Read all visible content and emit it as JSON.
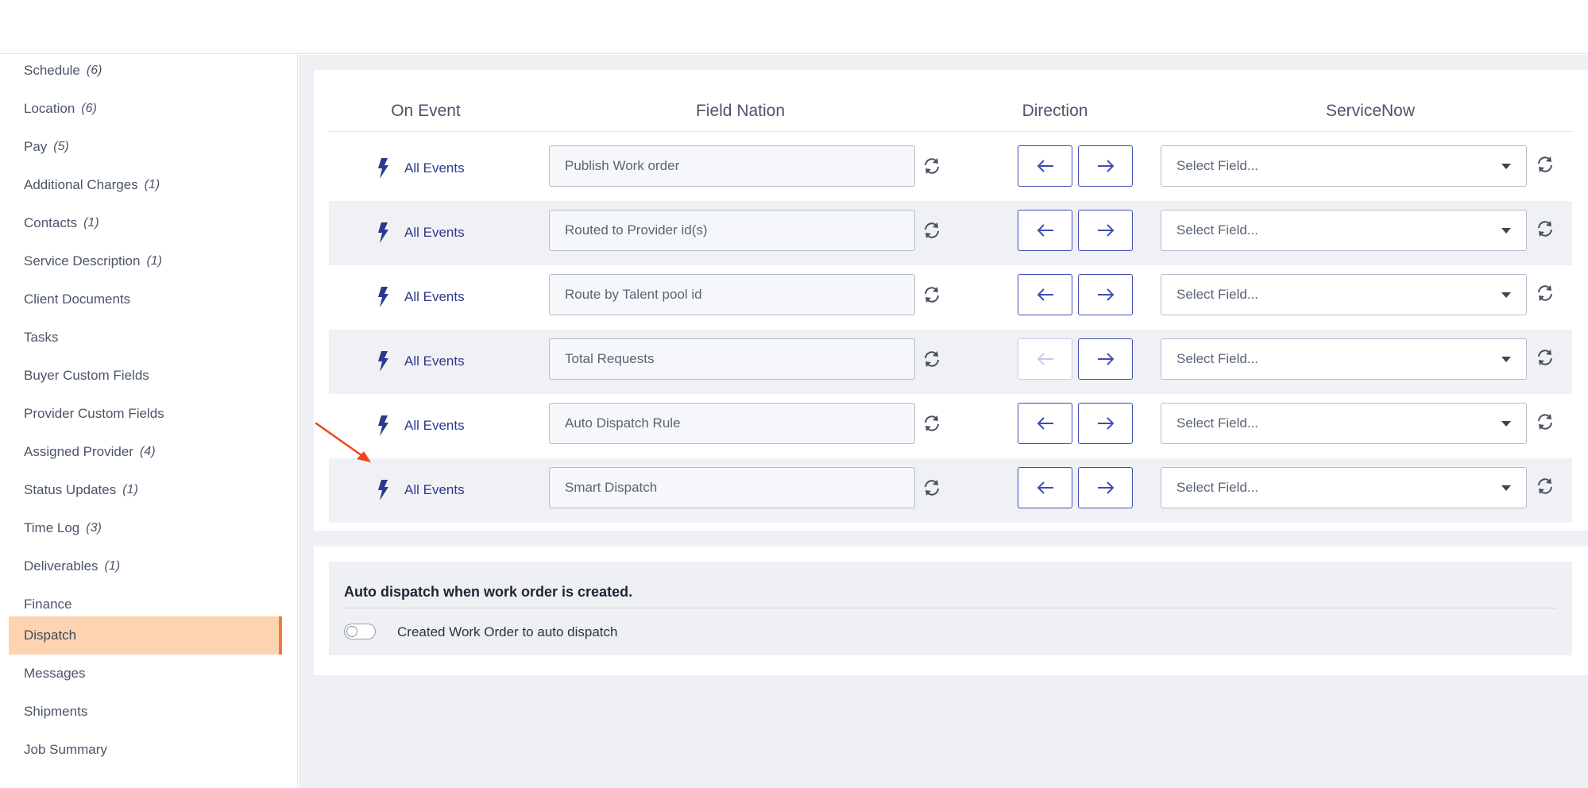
{
  "sidebar": {
    "items": [
      {
        "label": "Schedule",
        "count": "(6)"
      },
      {
        "label": "Location",
        "count": "(6)"
      },
      {
        "label": "Pay",
        "count": "(5)"
      },
      {
        "label": "Additional Charges",
        "count": "(1)"
      },
      {
        "label": "Contacts",
        "count": "(1)"
      },
      {
        "label": "Service Description",
        "count": "(1)"
      },
      {
        "label": "Client Documents",
        "count": ""
      },
      {
        "label": "Tasks",
        "count": ""
      },
      {
        "label": "Buyer Custom Fields",
        "count": ""
      },
      {
        "label": "Provider Custom Fields",
        "count": ""
      },
      {
        "label": "Assigned Provider",
        "count": "(4)"
      },
      {
        "label": "Status Updates",
        "count": "(1)"
      },
      {
        "label": "Time Log",
        "count": "(3)"
      },
      {
        "label": "Deliverables",
        "count": "(1)"
      },
      {
        "label": "Finance",
        "count": ""
      },
      {
        "label": "Dispatch",
        "count": "",
        "active": true
      },
      {
        "label": "Messages",
        "count": ""
      },
      {
        "label": "Shipments",
        "count": ""
      },
      {
        "label": "Job Summary",
        "count": ""
      }
    ]
  },
  "mapping": {
    "headers": {
      "on_event": "On Event",
      "field_nation": "Field Nation",
      "direction": "Direction",
      "servicenow": "ServiceNow"
    },
    "rows": [
      {
        "event": "All Events",
        "field": "Publish Work order",
        "select": "Select Field...",
        "left_disabled": false
      },
      {
        "event": "All Events",
        "field": "Routed to Provider id(s)",
        "select": "Select Field...",
        "left_disabled": false
      },
      {
        "event": "All Events",
        "field": "Route by Talent pool id",
        "select": "Select Field...",
        "left_disabled": false
      },
      {
        "event": "All Events",
        "field": "Total Requests",
        "select": "Select Field...",
        "left_disabled": true
      },
      {
        "event": "All Events",
        "field": "Auto Dispatch Rule",
        "select": "Select Field...",
        "left_disabled": false
      },
      {
        "event": "All Events",
        "field": "Smart Dispatch",
        "select": "Select Field...",
        "left_disabled": false
      }
    ]
  },
  "auto_dispatch": {
    "title": "Auto dispatch when work order is created.",
    "toggle_label": "Created Work Order to auto dispatch",
    "toggle_on": false
  },
  "colors": {
    "accent": "#3f4bb3",
    "active_bg": "#fdd3b0",
    "active_border": "#f07b36",
    "annotation_arrow": "#f0431e"
  },
  "icons": {
    "event": "lightning-bolt-icon",
    "sync": "sync-icon",
    "left": "arrow-left-icon",
    "right": "arrow-right-icon",
    "dropdown": "caret-down-icon"
  }
}
